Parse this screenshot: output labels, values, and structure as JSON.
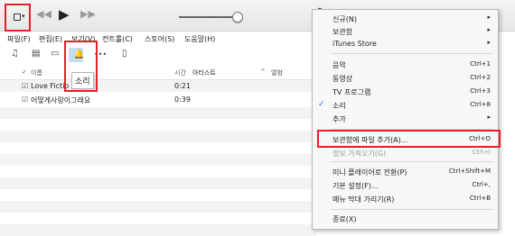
{
  "titlebar": {
    "library_icon": "library-icon",
    "library_caret": "▾",
    "prev_icon": "◀◀",
    "play_icon": "▶",
    "next_icon": "▶▶",
    "volume_level": 0.85,
    "right_icon_caret": "▾"
  },
  "menubar": {
    "items": [
      "파일(F)",
      "편집(E)",
      "보기(V)",
      "컨트롤(C)",
      "스토어(S)",
      "도움말(H)"
    ]
  },
  "toolbar": {
    "music_icon": "♫",
    "film_icon": "▤",
    "tv_icon": "▭",
    "bell_icon": "🔔",
    "more_icon": "•••",
    "device_icon": "▯"
  },
  "tooltip": "소리",
  "table": {
    "col_check": "✓",
    "col_name": "이름",
    "col_time": "시간",
    "col_artist": "아티스트",
    "col_sort": "^",
    "col_album": "앨범",
    "rows": [
      {
        "check": "☑",
        "title": "Love Fictio",
        "time": "0:21"
      },
      {
        "check": "☑",
        "title": "어떻게사랑이그래요",
        "time": "0:39"
      }
    ]
  },
  "menu": {
    "items": [
      {
        "label": "신규(N)",
        "shortcut": "",
        "arrow": "▸",
        "checked": false,
        "disabled": false
      },
      {
        "label": "보관함",
        "shortcut": "",
        "arrow": "▸",
        "checked": false,
        "disabled": false
      },
      {
        "label": "iTunes Store",
        "shortcut": "",
        "arrow": "▸",
        "checked": false,
        "disabled": false
      },
      {
        "label": "음악",
        "shortcut": "Ctrl+1",
        "arrow": "",
        "checked": false,
        "disabled": false
      },
      {
        "label": "동영상",
        "shortcut": "Ctrl+2",
        "arrow": "",
        "checked": false,
        "disabled": false
      },
      {
        "label": "TV 프로그램",
        "shortcut": "Ctrl+3",
        "arrow": "",
        "checked": false,
        "disabled": false
      },
      {
        "label": "소리",
        "shortcut": "Ctrl+8",
        "arrow": "",
        "checked": true,
        "disabled": false
      },
      {
        "label": "추가",
        "shortcut": "",
        "arrow": "▸",
        "checked": false,
        "disabled": false
      },
      {
        "label": "보관함에 파일 추가(A)...",
        "shortcut": "Ctrl+O",
        "arrow": "",
        "checked": false,
        "disabled": false
      },
      {
        "label": "정보 가져오기(G)",
        "shortcut": "Ctrl+I",
        "arrow": "",
        "checked": false,
        "disabled": true
      },
      {
        "label": "미니 플레이어로 전환(P)",
        "shortcut": "Ctrl+Shift+M",
        "arrow": "",
        "checked": false,
        "disabled": false
      },
      {
        "label": "기본 설정(F)...",
        "shortcut": "Ctrl+,",
        "arrow": "",
        "checked": false,
        "disabled": false
      },
      {
        "label": "메뉴 막대 가리기(R)",
        "shortcut": "Ctrl+B",
        "arrow": "",
        "checked": false,
        "disabled": false
      },
      {
        "label": "종료(X)",
        "shortcut": "",
        "arrow": "",
        "checked": false,
        "disabled": false
      }
    ]
  },
  "colors": {
    "highlight": "#e5202b",
    "accent": "#2a7fd4"
  }
}
